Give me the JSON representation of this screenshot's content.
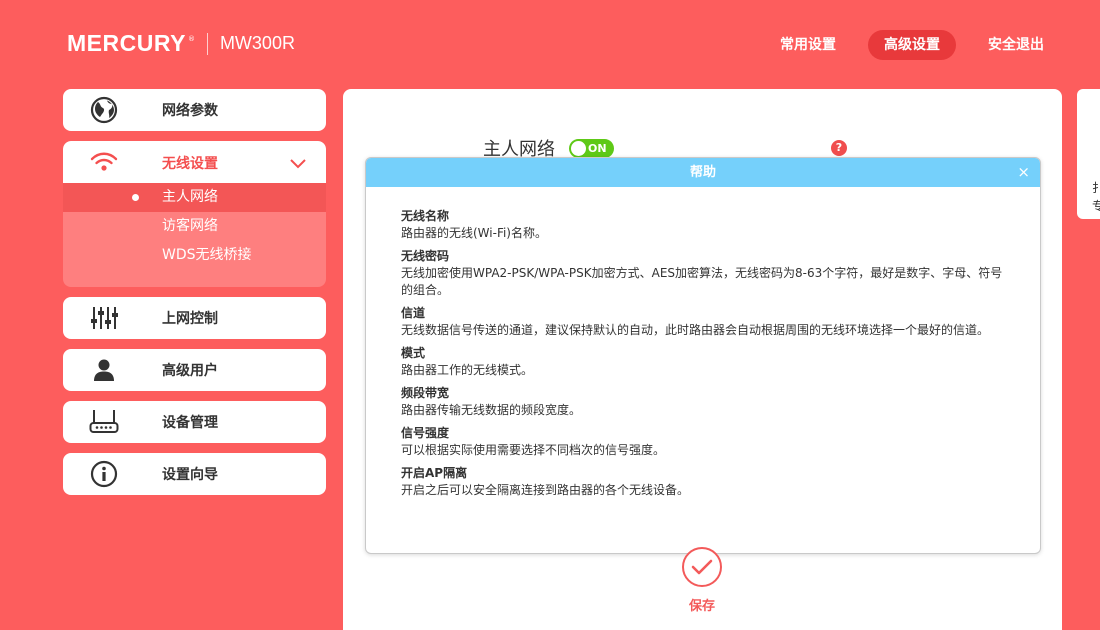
{
  "brand": {
    "logo": "MERCURY",
    "reg": "®",
    "model": "MW300R"
  },
  "topnav": [
    {
      "label": "常用设置"
    },
    {
      "label": "高级设置"
    },
    {
      "label": "安全退出"
    }
  ],
  "sidebar": {
    "network_params": "网络参数",
    "wireless": {
      "label": "无线设置",
      "sub": [
        "主人网络",
        "访客网络",
        "WDS无线桥接"
      ]
    },
    "internet_control": "上网控制",
    "advanced_users": "高级用户",
    "device_mgmt": "设备管理",
    "setup_wizard": "设置向导"
  },
  "main": {
    "host_network_label": "主人网络",
    "toggle_state": "ON",
    "help_icon": "?",
    "save_label": "保存"
  },
  "right_edge": {
    "frag1": "扌",
    "frag2": "专"
  },
  "help": {
    "title": "帮助",
    "close": "×",
    "sections": [
      {
        "title": "无线名称",
        "text": "路由器的无线(Wi-Fi)名称。"
      },
      {
        "title": "无线密码",
        "text": "无线加密使用WPA2-PSK/WPA-PSK加密方式、AES加密算法，无线密码为8-63个字符，最好是数字、字母、符号的组合。"
      },
      {
        "title": "信道",
        "text": "无线数据信号传送的通道，建议保持默认的自动，此时路由器会自动根据周围的无线环境选择一个最好的信道。"
      },
      {
        "title": "模式",
        "text": "路由器工作的无线模式。"
      },
      {
        "title": "频段带宽",
        "text": "路由器传输无线数据的频段宽度。"
      },
      {
        "title": "信号强度",
        "text": "可以根据实际使用需要选择不同档次的信号强度。"
      },
      {
        "title": "开启AP隔离",
        "text": "开启之后可以安全隔离连接到路由器的各个无线设备。"
      }
    ]
  },
  "colors": {
    "background": "#fd5d5d",
    "accent": "#f35656",
    "toggle_on": "#5ec917",
    "modal_header": "#75d0fb"
  }
}
